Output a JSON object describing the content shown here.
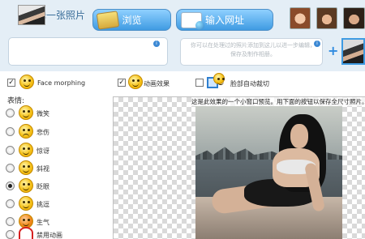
{
  "header": {
    "choose_photo_label": "选择一张照片",
    "browse_label": "浏览",
    "enter_url_label": "输入网址"
  },
  "icons": {
    "info": "i",
    "plus": "+",
    "checkmark": "✓"
  },
  "upload": {
    "hint_text": "你可以在处理过的照片添加到这儿以进一步编辑，保存及制作相册。"
  },
  "options": {
    "face_morphing": {
      "label": "Face morphing",
      "checked": true
    },
    "animation_effect": {
      "label": "动画效果",
      "checked": true
    },
    "auto_crop": {
      "label": "脸部自动裁切",
      "checked": false
    }
  },
  "expressions": {
    "heading": "表情:",
    "items": [
      {
        "label": "微笑",
        "selected": false
      },
      {
        "label": "悲伤",
        "selected": false
      },
      {
        "label": "惊讶",
        "selected": false
      },
      {
        "label": "斜视",
        "selected": false
      },
      {
        "label": "眨眼",
        "selected": true
      },
      {
        "label": "挑逗",
        "selected": false
      },
      {
        "label": "生气",
        "selected": false
      },
      {
        "label": "禁用动画",
        "selected": false
      }
    ]
  },
  "preview": {
    "caption": "这是此效果的一个小窗口预览。用下面的按钮以保存全尺寸照片。"
  },
  "colors": {
    "accent": "#3f9be2",
    "panel_bg": "#e4eef6"
  }
}
